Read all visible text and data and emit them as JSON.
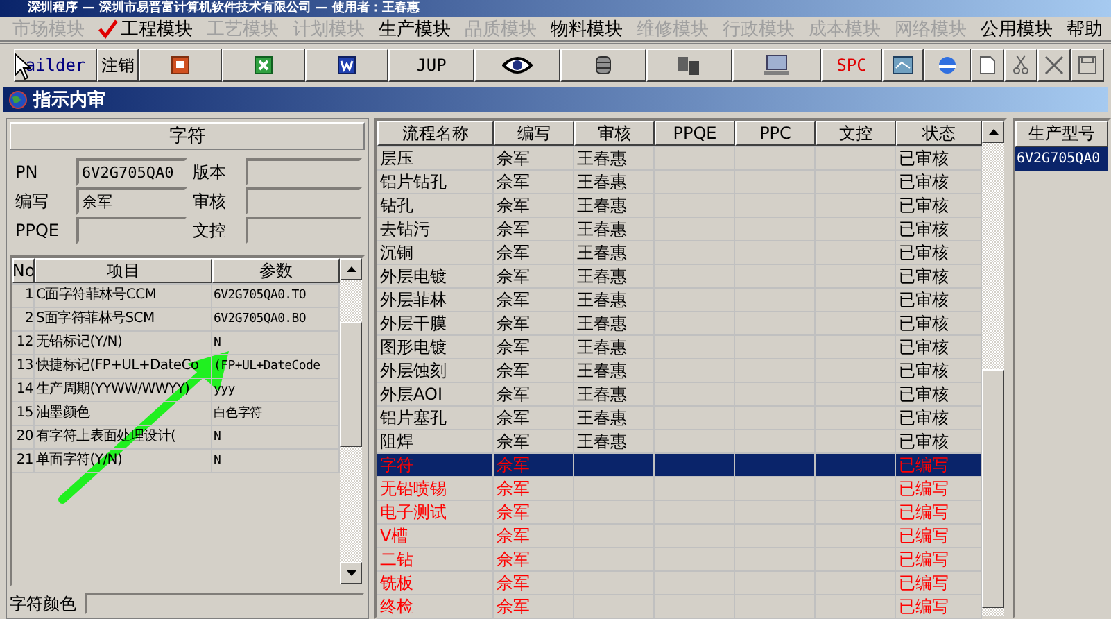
{
  "window": {
    "title": "深圳程序 — 深圳市易晋富计算机软件技术有限公司 — 使用者：王春惠"
  },
  "menu": [
    {
      "label": "市场模块",
      "disabled": true,
      "checked": false
    },
    {
      "label": "工程模块",
      "disabled": false,
      "checked": true
    },
    {
      "label": "工艺模块",
      "disabled": true,
      "checked": false
    },
    {
      "label": "计划模块",
      "disabled": true,
      "checked": false
    },
    {
      "label": "生产模块",
      "disabled": false,
      "checked": false
    },
    {
      "label": "品质模块",
      "disabled": true,
      "checked": false
    },
    {
      "label": "物料模块",
      "disabled": false,
      "checked": false
    },
    {
      "label": "维修模块",
      "disabled": true,
      "checked": false
    },
    {
      "label": "行政模块",
      "disabled": true,
      "checked": false
    },
    {
      "label": "成本模块",
      "disabled": true,
      "checked": false
    },
    {
      "label": "网络模块",
      "disabled": true,
      "checked": false
    },
    {
      "label": "公用模块",
      "disabled": false,
      "checked": false
    },
    {
      "label": "帮助",
      "disabled": false,
      "checked": false
    }
  ],
  "toolbar": [
    {
      "kind": "text",
      "label": "ailder"
    },
    {
      "kind": "text",
      "label": "注销"
    },
    {
      "kind": "ppt"
    },
    {
      "kind": "excel"
    },
    {
      "kind": "word"
    },
    {
      "kind": "text",
      "label": "JUP"
    },
    {
      "kind": "eye"
    },
    {
      "kind": "database"
    },
    {
      "kind": "servers"
    },
    {
      "kind": "computer"
    },
    {
      "kind": "redtext",
      "label": "SPC"
    },
    {
      "kind": "board"
    },
    {
      "kind": "browser"
    },
    {
      "kind": "new"
    },
    {
      "kind": "cut"
    },
    {
      "kind": "delete"
    },
    {
      "kind": "save"
    }
  ],
  "panel": {
    "title": "指示内审",
    "section": "字符",
    "fields": [
      {
        "label": "PN",
        "value": "6V2G705QA0"
      },
      {
        "label": "版本"
      },
      {
        "label": "编写",
        "value": "佘军"
      },
      {
        "label": "审核"
      },
      {
        "label": "PPQE"
      },
      {
        "label": "文控"
      }
    ],
    "grid": {
      "columns": [
        "No",
        "项目",
        "参数"
      ],
      "rows": [
        [
          "1",
          "C面字符菲林号CCM",
          "6V2G705QA0.TO"
        ],
        [
          "2",
          "S面字符菲林号SCM",
          "6V2G705QA0.BO"
        ],
        [
          "12",
          "无铅标记(Y/N)",
          "N"
        ],
        [
          "13",
          "快捷标记(FP+UL+DateCo",
          "(FP+UL+DateCode"
        ],
        [
          "14",
          "生产周期(YYWW/WWYY)",
          "yyy"
        ],
        [
          "15",
          "油墨颜色",
          "白色字符"
        ],
        [
          "20",
          "有字符上表面处理设计(",
          "N"
        ],
        [
          "21",
          "单面字符(Y/N)",
          "N"
        ]
      ]
    },
    "combo_label": "字符颜色"
  },
  "flow": {
    "columns": [
      "流程名称",
      "编写",
      "审核",
      "PPQE",
      "PPC",
      "文控",
      "状态"
    ],
    "rows": [
      {
        "cells": [
          "层压",
          "佘军",
          "王春惠",
          "",
          "",
          "",
          "已审核"
        ],
        "kind": "reviewed",
        "selected": false
      },
      {
        "cells": [
          "铝片钻孔",
          "佘军",
          "王春惠",
          "",
          "",
          "",
          "已审核"
        ],
        "kind": "reviewed",
        "selected": false
      },
      {
        "cells": [
          "钻孔",
          "佘军",
          "王春惠",
          "",
          "",
          "",
          "已审核"
        ],
        "kind": "reviewed",
        "selected": false
      },
      {
        "cells": [
          "去钻污",
          "佘军",
          "王春惠",
          "",
          "",
          "",
          "已审核"
        ],
        "kind": "reviewed",
        "selected": false
      },
      {
        "cells": [
          "沉铜",
          "佘军",
          "王春惠",
          "",
          "",
          "",
          "已审核"
        ],
        "kind": "reviewed",
        "selected": false
      },
      {
        "cells": [
          "外层电镀",
          "佘军",
          "王春惠",
          "",
          "",
          "",
          "已审核"
        ],
        "kind": "reviewed",
        "selected": false
      },
      {
        "cells": [
          "外层菲林",
          "佘军",
          "王春惠",
          "",
          "",
          "",
          "已审核"
        ],
        "kind": "reviewed",
        "selected": false
      },
      {
        "cells": [
          "外层干膜",
          "佘军",
          "王春惠",
          "",
          "",
          "",
          "已审核"
        ],
        "kind": "reviewed",
        "selected": false
      },
      {
        "cells": [
          "图形电镀",
          "佘军",
          "王春惠",
          "",
          "",
          "",
          "已审核"
        ],
        "kind": "reviewed",
        "selected": false
      },
      {
        "cells": [
          "外层蚀刻",
          "佘军",
          "王春惠",
          "",
          "",
          "",
          "已审核"
        ],
        "kind": "reviewed",
        "selected": false
      },
      {
        "cells": [
          "外层AOI",
          "佘军",
          "王春惠",
          "",
          "",
          "",
          "已审核"
        ],
        "kind": "reviewed",
        "selected": false
      },
      {
        "cells": [
          "铝片塞孔",
          "佘军",
          "王春惠",
          "",
          "",
          "",
          "已审核"
        ],
        "kind": "reviewed",
        "selected": false
      },
      {
        "cells": [
          "阻焊",
          "佘军",
          "王春惠",
          "",
          "",
          "",
          "已审核"
        ],
        "kind": "reviewed",
        "selected": false
      },
      {
        "cells": [
          "字符",
          "佘军",
          "",
          "",
          "",
          "",
          "已编写"
        ],
        "kind": "written",
        "selected": true
      },
      {
        "cells": [
          "无铅喷锡",
          "佘军",
          "",
          "",
          "",
          "",
          "已编写"
        ],
        "kind": "written",
        "selected": false
      },
      {
        "cells": [
          "电子测试",
          "佘军",
          "",
          "",
          "",
          "",
          "已编写"
        ],
        "kind": "written",
        "selected": false
      },
      {
        "cells": [
          "V槽",
          "佘军",
          "",
          "",
          "",
          "",
          "已编写"
        ],
        "kind": "written",
        "selected": false
      },
      {
        "cells": [
          "二钻",
          "佘军",
          "",
          "",
          "",
          "",
          "已编写"
        ],
        "kind": "written",
        "selected": false
      },
      {
        "cells": [
          "铣板",
          "佘军",
          "",
          "",
          "",
          "",
          "已编写"
        ],
        "kind": "written",
        "selected": false
      },
      {
        "cells": [
          "终检",
          "佘军",
          "",
          "",
          "",
          "",
          "已编写"
        ],
        "kind": "written",
        "selected": false
      }
    ]
  },
  "models": {
    "header": "生产型号",
    "items": [
      {
        "label": "6V2G705QA0",
        "selected": true
      }
    ]
  }
}
